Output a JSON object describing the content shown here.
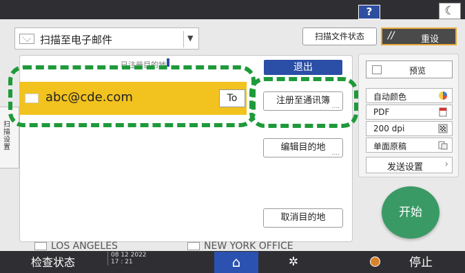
{
  "top": {
    "help_label": "?",
    "theme_icon": "moon-icon",
    "theme_glyph": "☾"
  },
  "header": {
    "scan_mode": "扫描至电子邮件",
    "scan_status_button": "扫描文件状态",
    "reset_button": "重设",
    "reset_glyph": "//"
  },
  "left_tab": {
    "label": "扫描设置"
  },
  "destination": {
    "peek_header": "已注册目的地",
    "exit_button": "退出",
    "selected_address": "abc@cde.com",
    "to_button": "To",
    "register_button": "注册至通讯簿",
    "edit_button": "编辑目的地",
    "cancel_button": "取消目的地",
    "dots": "....",
    "city_1": "LOS ANGELES",
    "city_2": "NEW YORK OFFICE"
  },
  "settings": {
    "preview_label": "预览",
    "color_mode": "自动颜色",
    "file_type": "PDF",
    "resolution": "200 dpi",
    "sides": "单面原稿",
    "send_settings": "发送设置"
  },
  "start_button": "开始",
  "bottom": {
    "check_status": "检查状态",
    "date": "08 12 2022",
    "time": "17 : 21",
    "home_glyph": "⌂",
    "gear_glyph": "✲",
    "stop_label": "停止"
  },
  "colors": {
    "accent_blue": "#2b4ea6",
    "highlight_green": "#1f9a3a",
    "selected_yellow": "#f2c21e",
    "start_green": "#3a9a66"
  }
}
